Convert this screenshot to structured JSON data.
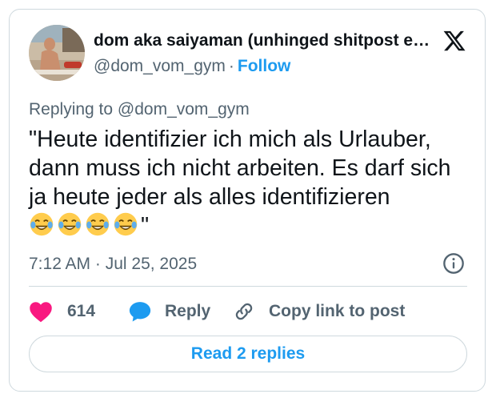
{
  "author": {
    "display_name": "dom aka saiyaman (unhinged shitpost e…",
    "handle": "@dom_vom_gym",
    "separator": "·",
    "follow_label": "Follow",
    "avatar_icon": "profile-photo"
  },
  "brand": {
    "logo_icon": "x-logo",
    "accent_color": "#1d9bf0",
    "like_color": "#f91880"
  },
  "tweet": {
    "replying_to": "Replying to @dom_vom_gym",
    "text": "\"Heute identifizier ich mich als Urlauber, dann muss ich nicht arbeiten. Es darf sich ja heute jeder als alles identifizieren",
    "emojis": [
      "😂",
      "😂",
      "😂",
      "😂"
    ],
    "closing_quote": "\"",
    "timestamp": "7:12 AM · Jul 25, 2025"
  },
  "actions": {
    "like_count": "614",
    "reply_label": "Reply",
    "copy_label": "Copy link to post",
    "read_replies_label": "Read 2 replies"
  }
}
